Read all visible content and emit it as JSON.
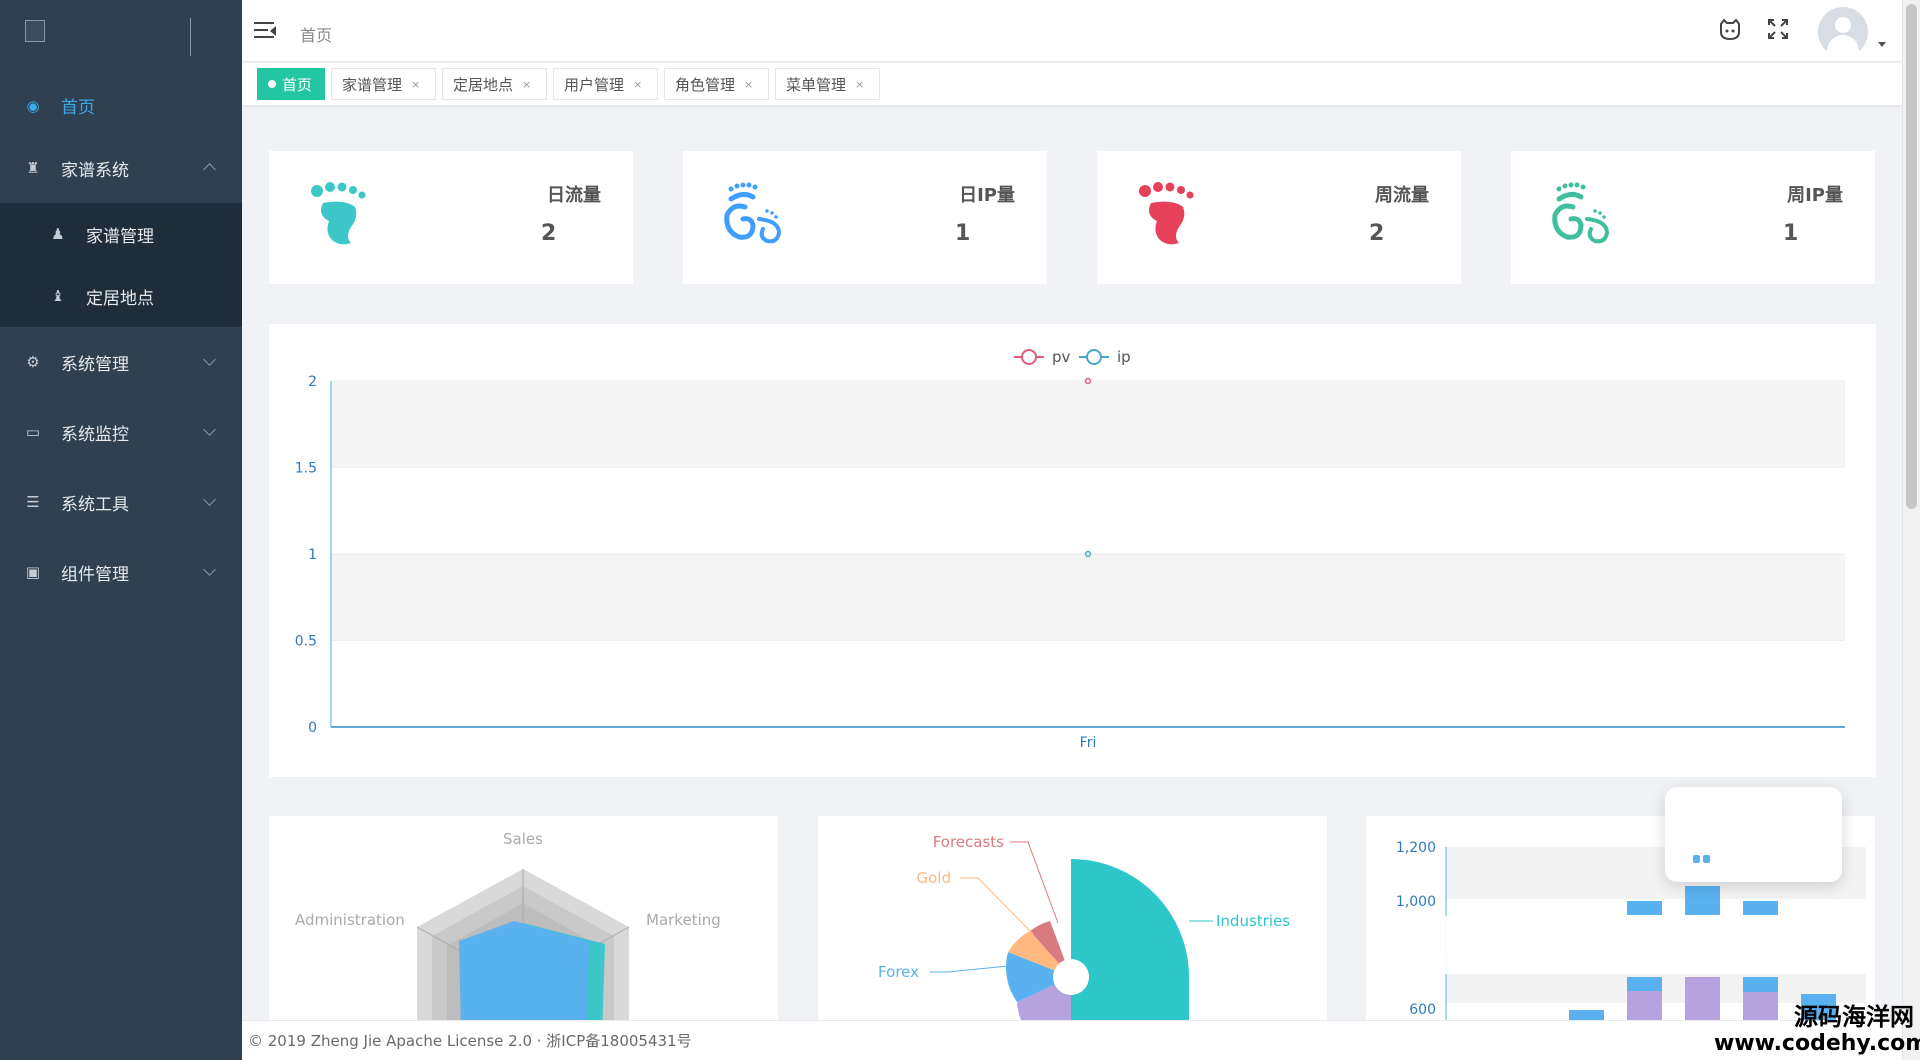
{
  "sidebar": {
    "items": [
      {
        "label": "首页",
        "icon": "dashboard-icon",
        "active": true
      },
      {
        "label": "家谱系统",
        "icon": "user-group-icon",
        "expanded": true,
        "children": [
          {
            "label": "家谱管理",
            "icon": "users-icon"
          },
          {
            "label": "定居地点",
            "icon": "user-tie-icon"
          }
        ]
      },
      {
        "label": "系统管理",
        "icon": "gear-icon"
      },
      {
        "label": "系统监控",
        "icon": "monitor-icon"
      },
      {
        "label": "系统工具",
        "icon": "toolbox-icon"
      },
      {
        "label": "组件管理",
        "icon": "briefcase-icon"
      }
    ]
  },
  "header": {
    "breadcrumb": "首页",
    "icons": [
      "github-icon",
      "fullscreen-icon"
    ]
  },
  "tabs": [
    {
      "label": "首页",
      "active": true
    },
    {
      "label": "家谱管理",
      "close": "×"
    },
    {
      "label": "定居地点",
      "close": "×"
    },
    {
      "label": "用户管理",
      "close": "×"
    },
    {
      "label": "角色管理",
      "close": "×"
    },
    {
      "label": "菜单管理",
      "close": "×"
    }
  ],
  "stats": [
    {
      "label": "日流量",
      "value": "2",
      "color": "#3ec7c9",
      "icon": "footprint-icon"
    },
    {
      "label": "日IP量",
      "value": "1",
      "color": "#409eff",
      "icon": "bigfoot-icon"
    },
    {
      "label": "周流量",
      "value": "2",
      "color": "#e6405a",
      "icon": "footprint-icon"
    },
    {
      "label": "周IP量",
      "value": "1",
      "color": "#3fbf9e",
      "icon": "bigfoot-icon"
    }
  ],
  "chart_data": [
    {
      "type": "line",
      "categories": [
        "Fri"
      ],
      "series": [
        {
          "name": "pv",
          "values": [
            2
          ],
          "color": "#e15b7c"
        },
        {
          "name": "ip",
          "values": [
            1
          ],
          "color": "#4aa8c7"
        }
      ],
      "ylim": [
        0,
        2
      ],
      "yticks": [
        "0",
        "0.5",
        "1",
        "1.5",
        "2"
      ],
      "legend": "top-center",
      "grid": true
    },
    {
      "type": "radar",
      "indicators": [
        "Sales",
        "Administration",
        "Marketing"
      ]
    },
    {
      "type": "pie",
      "labels": [
        "Industries",
        "Forecasts",
        "Gold",
        "Forex"
      ],
      "colors": {
        "Industries": "#2ec7c9",
        "Forecasts": "#d87a80",
        "Gold": "#ffb980",
        "Forex": "#5ab1ef"
      }
    },
    {
      "type": "bar",
      "yticks": [
        "1,200",
        "1,000",
        "600"
      ],
      "colors": [
        "#5ab1ef",
        "#b6a2de"
      ]
    }
  ],
  "footer": {
    "text": "© 2019 Zheng Jie Apache License 2.0 · 浙ICP备18005431号"
  },
  "watermark": {
    "line1": "源码海洋网",
    "line2": "www.codehy.com"
  }
}
